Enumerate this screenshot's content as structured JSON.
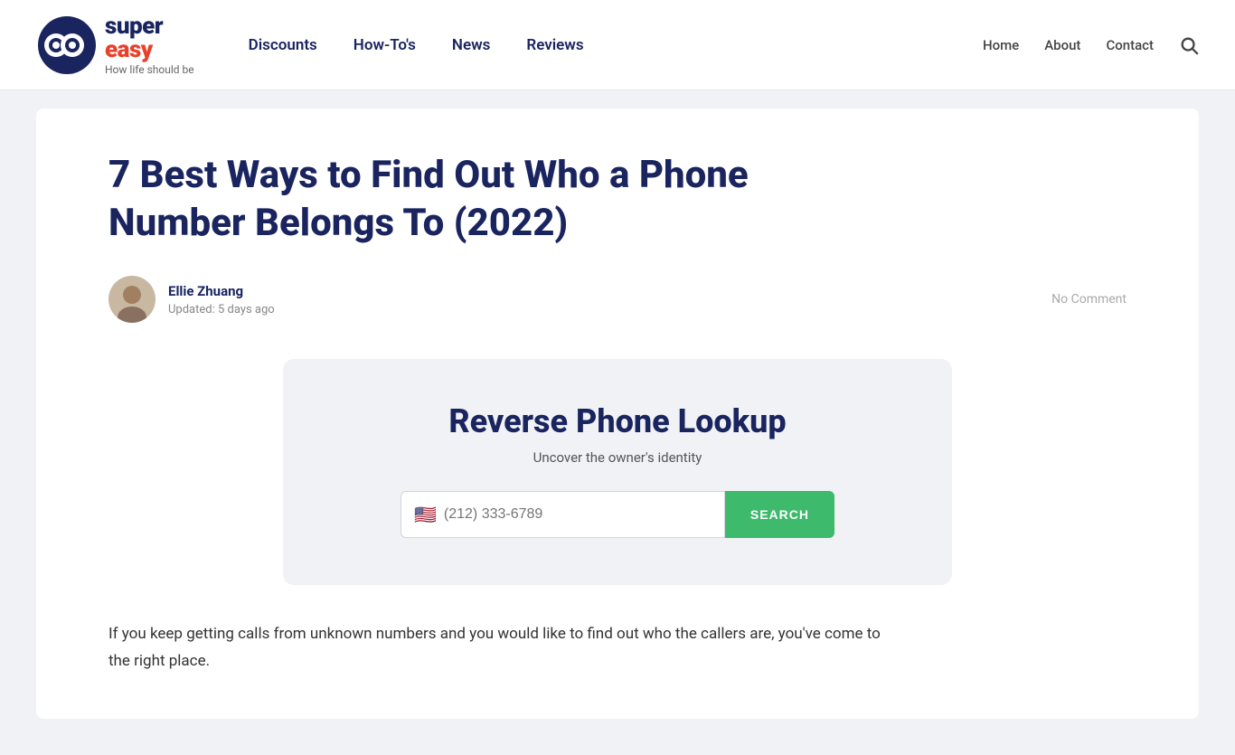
{
  "site": {
    "name_super": "super",
    "name_easy": "easy",
    "tagline": "How life should be"
  },
  "header": {
    "primary_nav": [
      {
        "label": "Discounts",
        "href": "#"
      },
      {
        "label": "How-To's",
        "href": "#"
      },
      {
        "label": "News",
        "href": "#"
      },
      {
        "label": "Reviews",
        "href": "#"
      }
    ],
    "secondary_nav": [
      {
        "label": "Home",
        "href": "#"
      },
      {
        "label": "About",
        "href": "#"
      },
      {
        "label": "Contact",
        "href": "#"
      }
    ]
  },
  "article": {
    "title": "7 Best Ways to Find Out Who a Phone Number Belongs To (2022)",
    "author": {
      "name": "Ellie Zhuang",
      "updated": "Updated: 5 days ago"
    },
    "no_comment": "No Comment",
    "lookup_widget": {
      "title": "Reverse Phone Lookup",
      "subtitle": "Uncover the owner's identity",
      "input_placeholder": "(212) 333-6789",
      "search_label": "SEARCH"
    },
    "body_text": "If you keep getting calls from unknown numbers and you would like to find out who the callers are, you've come to the right place."
  },
  "colors": {
    "brand_dark": "#1a2560",
    "brand_red": "#e8412a",
    "search_green": "#3dba6c"
  }
}
